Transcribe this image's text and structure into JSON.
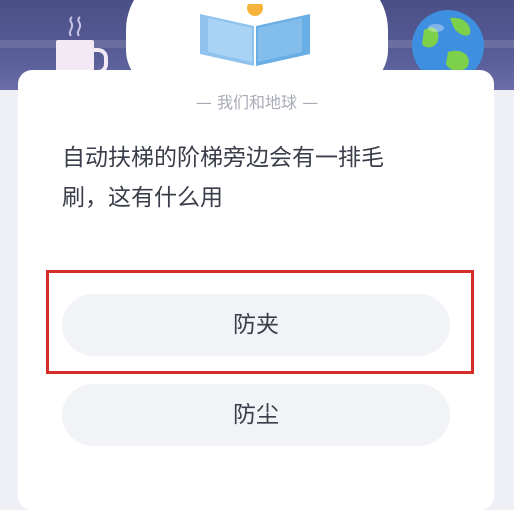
{
  "header": {
    "decor_icons": [
      "mug-icon",
      "cloud-icon",
      "book-icon",
      "globe-icon"
    ]
  },
  "quiz": {
    "category": "— 我们和地球 —",
    "question_line1": "自动扶梯的阶梯旁边会有一排毛",
    "question_line2": "刷，这有什么用",
    "options": [
      {
        "label": "防夹",
        "highlighted": true
      },
      {
        "label": "防尘",
        "highlighted": false
      }
    ]
  },
  "colors": {
    "header": "#4a4f86",
    "card": "#ffffff",
    "option_bg": "#f2f3f7",
    "highlight": "#d42b2b",
    "text": "#3a3d4a",
    "muted": "#a8abb6"
  }
}
